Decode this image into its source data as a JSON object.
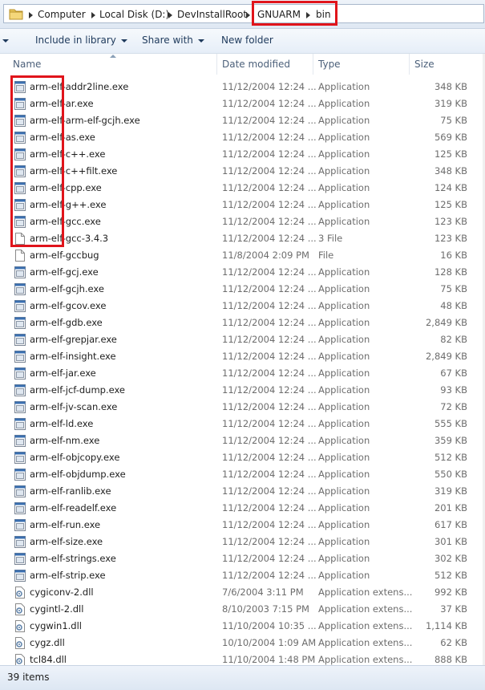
{
  "address": {
    "crumbs": [
      "Computer",
      "Local Disk (D:)",
      "DevInstallRoot",
      "GNUARM",
      "bin"
    ]
  },
  "toolbar": {
    "include_label": "Include in library",
    "share_label": "Share with",
    "newfolder_label": "New folder"
  },
  "columns": {
    "name": "Name",
    "date": "Date modified",
    "type": "Type",
    "size": "Size"
  },
  "files": [
    {
      "name": "arm-elf-addr2line.exe",
      "date": "11/12/2004 12:24 ...",
      "type": "Application",
      "size": "348 KB",
      "icon": "exe"
    },
    {
      "name": "arm-elf-ar.exe",
      "date": "11/12/2004 12:24 ...",
      "type": "Application",
      "size": "319 KB",
      "icon": "exe"
    },
    {
      "name": "arm-elf-arm-elf-gcjh.exe",
      "date": "11/12/2004 12:24 ...",
      "type": "Application",
      "size": "75 KB",
      "icon": "exe"
    },
    {
      "name": "arm-elf-as.exe",
      "date": "11/12/2004 12:24 ...",
      "type": "Application",
      "size": "569 KB",
      "icon": "exe"
    },
    {
      "name": "arm-elf-c++.exe",
      "date": "11/12/2004 12:24 ...",
      "type": "Application",
      "size": "125 KB",
      "icon": "exe"
    },
    {
      "name": "arm-elf-c++filt.exe",
      "date": "11/12/2004 12:24 ...",
      "type": "Application",
      "size": "348 KB",
      "icon": "exe"
    },
    {
      "name": "arm-elf-cpp.exe",
      "date": "11/12/2004 12:24 ...",
      "type": "Application",
      "size": "124 KB",
      "icon": "exe"
    },
    {
      "name": "arm-elf-g++.exe",
      "date": "11/12/2004 12:24 ...",
      "type": "Application",
      "size": "125 KB",
      "icon": "exe"
    },
    {
      "name": "arm-elf-gcc.exe",
      "date": "11/12/2004 12:24 ...",
      "type": "Application",
      "size": "123 KB",
      "icon": "exe"
    },
    {
      "name": "arm-elf-gcc-3.4.3",
      "date": "11/12/2004 12:24 ...",
      "type": "3 File",
      "size": "123 KB",
      "icon": "file"
    },
    {
      "name": "arm-elf-gccbug",
      "date": "11/8/2004 2:09 PM",
      "type": "File",
      "size": "16 KB",
      "icon": "file"
    },
    {
      "name": "arm-elf-gcj.exe",
      "date": "11/12/2004 12:24 ...",
      "type": "Application",
      "size": "128 KB",
      "icon": "exe"
    },
    {
      "name": "arm-elf-gcjh.exe",
      "date": "11/12/2004 12:24 ...",
      "type": "Application",
      "size": "75 KB",
      "icon": "exe"
    },
    {
      "name": "arm-elf-gcov.exe",
      "date": "11/12/2004 12:24 ...",
      "type": "Application",
      "size": "48 KB",
      "icon": "exe"
    },
    {
      "name": "arm-elf-gdb.exe",
      "date": "11/12/2004 12:24 ...",
      "type": "Application",
      "size": "2,849 KB",
      "icon": "exe"
    },
    {
      "name": "arm-elf-grepjar.exe",
      "date": "11/12/2004 12:24 ...",
      "type": "Application",
      "size": "82 KB",
      "icon": "exe"
    },
    {
      "name": "arm-elf-insight.exe",
      "date": "11/12/2004 12:24 ...",
      "type": "Application",
      "size": "2,849 KB",
      "icon": "exe"
    },
    {
      "name": "arm-elf-jar.exe",
      "date": "11/12/2004 12:24 ...",
      "type": "Application",
      "size": "67 KB",
      "icon": "exe"
    },
    {
      "name": "arm-elf-jcf-dump.exe",
      "date": "11/12/2004 12:24 ...",
      "type": "Application",
      "size": "93 KB",
      "icon": "exe"
    },
    {
      "name": "arm-elf-jv-scan.exe",
      "date": "11/12/2004 12:24 ...",
      "type": "Application",
      "size": "72 KB",
      "icon": "exe"
    },
    {
      "name": "arm-elf-ld.exe",
      "date": "11/12/2004 12:24 ...",
      "type": "Application",
      "size": "555 KB",
      "icon": "exe"
    },
    {
      "name": "arm-elf-nm.exe",
      "date": "11/12/2004 12:24 ...",
      "type": "Application",
      "size": "359 KB",
      "icon": "exe"
    },
    {
      "name": "arm-elf-objcopy.exe",
      "date": "11/12/2004 12:24 ...",
      "type": "Application",
      "size": "512 KB",
      "icon": "exe"
    },
    {
      "name": "arm-elf-objdump.exe",
      "date": "11/12/2004 12:24 ...",
      "type": "Application",
      "size": "550 KB",
      "icon": "exe"
    },
    {
      "name": "arm-elf-ranlib.exe",
      "date": "11/12/2004 12:24 ...",
      "type": "Application",
      "size": "319 KB",
      "icon": "exe"
    },
    {
      "name": "arm-elf-readelf.exe",
      "date": "11/12/2004 12:24 ...",
      "type": "Application",
      "size": "201 KB",
      "icon": "exe"
    },
    {
      "name": "arm-elf-run.exe",
      "date": "11/12/2004 12:24 ...",
      "type": "Application",
      "size": "617 KB",
      "icon": "exe"
    },
    {
      "name": "arm-elf-size.exe",
      "date": "11/12/2004 12:24 ...",
      "type": "Application",
      "size": "301 KB",
      "icon": "exe"
    },
    {
      "name": "arm-elf-strings.exe",
      "date": "11/12/2004 12:24 ...",
      "type": "Application",
      "size": "302 KB",
      "icon": "exe"
    },
    {
      "name": "arm-elf-strip.exe",
      "date": "11/12/2004 12:24 ...",
      "type": "Application",
      "size": "512 KB",
      "icon": "exe"
    },
    {
      "name": "cygiconv-2.dll",
      "date": "7/6/2004 3:11 PM",
      "type": "Application extens...",
      "size": "992 KB",
      "icon": "dll"
    },
    {
      "name": "cygintl-2.dll",
      "date": "8/10/2003 7:15 PM",
      "type": "Application extens...",
      "size": "37 KB",
      "icon": "dll"
    },
    {
      "name": "cygwin1.dll",
      "date": "11/10/2004 10:35 ...",
      "type": "Application extens...",
      "size": "1,114 KB",
      "icon": "dll"
    },
    {
      "name": "cygz.dll",
      "date": "10/10/2004 1:09 AM",
      "type": "Application extens...",
      "size": "62 KB",
      "icon": "dll"
    },
    {
      "name": "tcl84.dll",
      "date": "11/10/2004 1:48 PM",
      "type": "Application extens...",
      "size": "888 KB",
      "icon": "dll"
    }
  ],
  "status": {
    "count": "39 items"
  },
  "colors": {
    "highlight": "#e0141b"
  }
}
